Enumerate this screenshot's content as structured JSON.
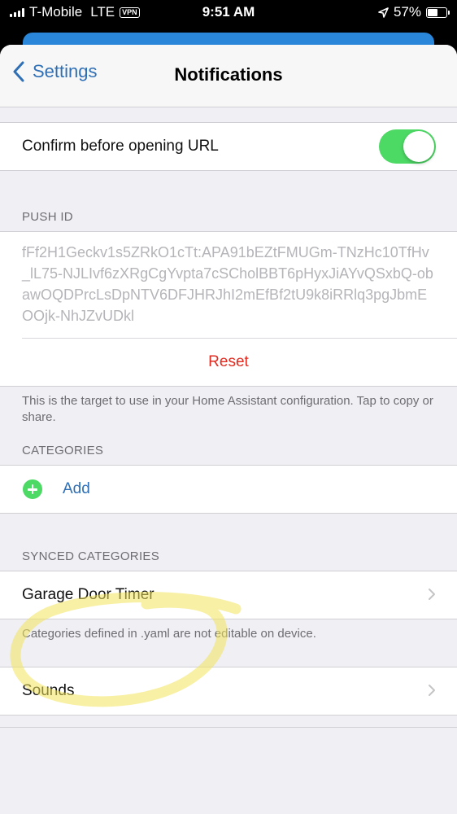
{
  "status_bar": {
    "carrier": "T-Mobile",
    "network": "LTE",
    "vpn": "VPN",
    "time": "9:51 AM",
    "battery": "57%",
    "battery_level": 0.57
  },
  "nav": {
    "back_label": "Settings",
    "title": "Notifications"
  },
  "confirm_url": {
    "label": "Confirm before opening URL",
    "enabled": true
  },
  "push_id": {
    "header": "PUSH ID",
    "value": "fFf2H1Geckv1s5ZRkO1cTt:APA91bEZtFMUGm-TNzHc10TfHv_lL75-NJLIvf6zXRgCgYvpta7cSCholBBT6pHyxJiAYvQSxbQ-obawOQDPrcLsDpNTV6DFJHRJhI2mEfBf2tU9k8iRRlq3pgJbmEOOjk-NhJZvUDkl",
    "reset_label": "Reset",
    "footer": "This is the target to use in your Home Assistant configuration. Tap to copy or share."
  },
  "categories": {
    "header": "CATEGORIES",
    "add_label": "Add"
  },
  "synced_categories": {
    "header": "SYNCED CATEGORIES",
    "items": [
      {
        "label": "Garage Door Timer"
      }
    ],
    "footer": "Categories defined in .yaml are not editable on device."
  },
  "sounds": {
    "label": "Sounds"
  },
  "colors": {
    "accent": "#2f6fb5",
    "toggle_on": "#4cd964",
    "destructive": "#e02b20",
    "highlight": "#f2e35a"
  }
}
